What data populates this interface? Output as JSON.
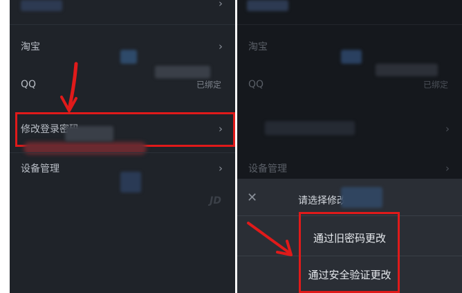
{
  "left_panel": {
    "items": [
      {
        "label": "淘宝",
        "value": ""
      },
      {
        "label": "QQ",
        "value": "已绑定"
      },
      {
        "label": "修改登录密码",
        "value": ""
      },
      {
        "label": "设备管理",
        "value": ""
      }
    ],
    "chevron": "›",
    "watermark": "JD"
  },
  "right_panel": {
    "items": [
      {
        "label": "淘宝",
        "value": ""
      },
      {
        "label": "QQ",
        "value": "已绑定"
      },
      {
        "label": "",
        "value": ""
      },
      {
        "label": "设备管理",
        "value": ""
      }
    ],
    "sheet": {
      "close_icon": "✕",
      "title": "请选择修改方式",
      "options": [
        "通过旧密码更改",
        "通过安全验证更改"
      ]
    }
  },
  "annotation_color": "#e01a1a",
  "theme": {
    "bg_left": "#1f2329",
    "bg_right": "#15181d",
    "sheet_bg": "#2a2e35"
  }
}
